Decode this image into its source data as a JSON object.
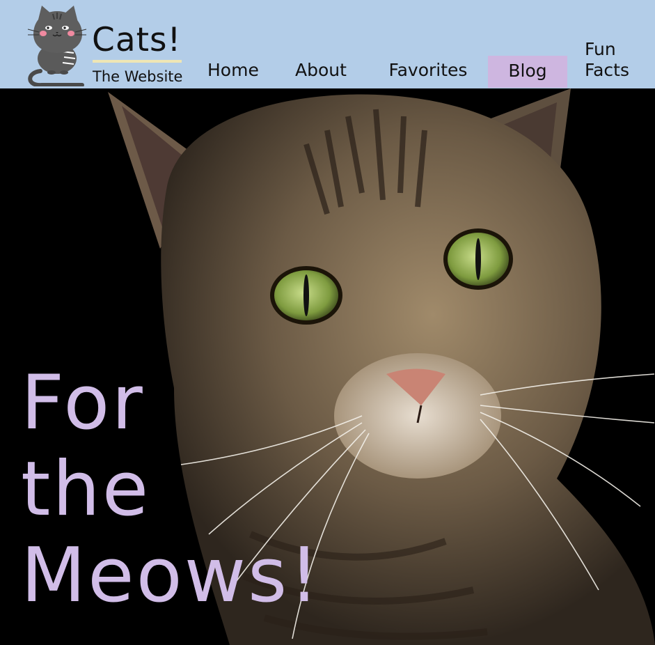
{
  "brand": {
    "title": "Cats!",
    "subtitle": "The Website",
    "logo_icon": "cartoon-cat-icon"
  },
  "nav": {
    "items": [
      {
        "label": "Home"
      },
      {
        "label": "About"
      },
      {
        "label": "Favorites"
      },
      {
        "label": "Blog",
        "active": true
      },
      {
        "label": "Fun\nFacts"
      }
    ]
  },
  "hero": {
    "image": "tabby-cat-photo",
    "tagline": "For\nthe\nMeows!"
  },
  "colors": {
    "header_bg": "#b3cde8",
    "active_nav": "#ceb6e0",
    "tagline": "#d1bde8",
    "underline": "#efe6b4"
  }
}
